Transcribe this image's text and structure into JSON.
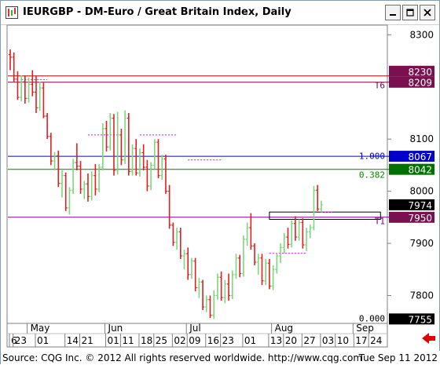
{
  "window": {
    "title": "IEURGBP - DM-Euro / Great Britain Index, Daily",
    "buttons": [
      "minimize",
      "maximize",
      "close"
    ]
  },
  "footer": {
    "source": "Source: CQG Inc. © 2012 All rights reserved worldwide. http://www.cqg.com",
    "date": "Tue Sep 11 2012"
  },
  "colors": {
    "up_bar": "#7cd87c",
    "down_bar": "#e02020",
    "line_red": "#c00000",
    "line_maroon": "#800040",
    "line_blue": "#0000e0",
    "line_green": "#008000",
    "line_purple": "#800080",
    "magenta_dash": "#ff00ff",
    "tag_maroon": "#7b1050",
    "tag_blue": "#0000c8",
    "tag_green": "#007000",
    "tag_black": "#000000"
  },
  "chart_data": {
    "type": "candlestick",
    "title": "IEURGBP - DM-Euro / Great Britain Index, Daily",
    "ylim": [
      7748,
      8317
    ],
    "y_ticks": [
      {
        "value": 8300,
        "label": "8300"
      },
      {
        "value": 8100,
        "label": "8100"
      },
      {
        "value": 8000,
        "label": "8000"
      },
      {
        "value": 7900,
        "label": "7900"
      },
      {
        "value": 7800,
        "label": "7800"
      }
    ],
    "month_labels": [
      {
        "label": "May",
        "day": 5
      },
      {
        "label": "Jun",
        "day": 26
      },
      {
        "label": "Jul",
        "day": 48
      },
      {
        "label": "Aug",
        "day": 71
      },
      {
        "label": "Sep",
        "day": 93
      }
    ],
    "day_labels": [
      {
        "label": "6",
        "day": 0
      },
      {
        "label": "23",
        "day": 1
      },
      {
        "label": "01",
        "day": 7
      },
      {
        "label": "14",
        "day": 15
      },
      {
        "label": "21",
        "day": 19
      },
      {
        "label": "01",
        "day": 26
      },
      {
        "label": "11",
        "day": 30
      },
      {
        "label": "18",
        "day": 35
      },
      {
        "label": "25",
        "day": 39
      },
      {
        "label": "02",
        "day": 44
      },
      {
        "label": "09",
        "day": 48
      },
      {
        "label": "16",
        "day": 53
      },
      {
        "label": "23",
        "day": 57
      },
      {
        "label": "01",
        "day": 63
      },
      {
        "label": "13",
        "day": 70
      },
      {
        "label": "20",
        "day": 74
      },
      {
        "label": "27",
        "day": 79
      },
      {
        "label": "03",
        "day": 84
      },
      {
        "label": "10",
        "day": 88
      },
      {
        "label": "17",
        "day": 93
      },
      {
        "label": "24",
        "day": 97
      }
    ],
    "price_tags": [
      {
        "value": 8230,
        "label": "8230",
        "color": "#7b1050"
      },
      {
        "value": 8209,
        "label": "8209",
        "color": "#7b1050"
      },
      {
        "value": 8067,
        "label": "8067",
        "color": "#0000c8"
      },
      {
        "value": 8042,
        "label": "8042",
        "color": "#007000"
      },
      {
        "value": 7974,
        "label": "7974",
        "color": "#000000"
      },
      {
        "value": 7950,
        "label": "7950",
        "color": "#7b1050"
      },
      {
        "value": 7755,
        "label": "7755",
        "color": "#000000"
      }
    ],
    "horizontal_lines": [
      {
        "value": 8221,
        "color": "#c00000"
      },
      {
        "value": 8209,
        "color": "#800040"
      },
      {
        "value": 8067,
        "color": "#0000e0"
      },
      {
        "value": 8042,
        "color": "#008000"
      },
      {
        "value": 7950,
        "color": "#800080"
      }
    ],
    "line_labels": [
      {
        "value": 8203,
        "label": "T6",
        "color": "#800040"
      },
      {
        "value": 8068,
        "label": "1.000",
        "color": "#0000e0"
      },
      {
        "value": 8032,
        "label": "0.382",
        "color": "#008000"
      },
      {
        "value": 7943,
        "label": "T1",
        "color": "#800080"
      },
      {
        "value": 7756,
        "label": "0.000",
        "color": "#000000"
      }
    ],
    "candles": [
      {
        "o": 8262,
        "h": 8272,
        "l": 8232,
        "c": 8257
      },
      {
        "o": 8257,
        "h": 8266,
        "l": 8210,
        "c": 8215
      },
      {
        "o": 8215,
        "h": 8230,
        "l": 8175,
        "c": 8180
      },
      {
        "o": 8180,
        "h": 8222,
        "l": 8172,
        "c": 8210
      },
      {
        "o": 8210,
        "h": 8222,
        "l": 8168,
        "c": 8178
      },
      {
        "o": 8178,
        "h": 8218,
        "l": 8170,
        "c": 8205
      },
      {
        "o": 8205,
        "h": 8232,
        "l": 8182,
        "c": 8190
      },
      {
        "o": 8190,
        "h": 8222,
        "l": 8150,
        "c": 8160
      },
      {
        "o": 8160,
        "h": 8210,
        "l": 8154,
        "c": 8198
      },
      {
        "o": 8198,
        "h": 8208,
        "l": 8140,
        "c": 8144
      },
      {
        "o": 8144,
        "h": 8150,
        "l": 8100,
        "c": 8105
      },
      {
        "o": 8105,
        "h": 8112,
        "l": 8050,
        "c": 8058
      },
      {
        "o": 8058,
        "h": 8075,
        "l": 8040,
        "c": 8068
      },
      {
        "o": 8068,
        "h": 8078,
        "l": 8008,
        "c": 8015
      },
      {
        "o": 8015,
        "h": 8040,
        "l": 7988,
        "c": 8030
      },
      {
        "o": 8030,
        "h": 8036,
        "l": 7962,
        "c": 7968
      },
      {
        "o": 7968,
        "h": 8008,
        "l": 7955,
        "c": 8002
      },
      {
        "o": 8002,
        "h": 8062,
        "l": 7995,
        "c": 8055
      },
      {
        "o": 8055,
        "h": 8092,
        "l": 8040,
        "c": 8048
      },
      {
        "o": 8048,
        "h": 8058,
        "l": 7995,
        "c": 8004
      },
      {
        "o": 8004,
        "h": 8020,
        "l": 7985,
        "c": 8014
      },
      {
        "o": 8014,
        "h": 8034,
        "l": 7980,
        "c": 7990
      },
      {
        "o": 7990,
        "h": 8038,
        "l": 7982,
        "c": 8030
      },
      {
        "o": 8030,
        "h": 8052,
        "l": 7992,
        "c": 8004
      },
      {
        "o": 8004,
        "h": 8052,
        "l": 7998,
        "c": 8046
      },
      {
        "o": 8046,
        "h": 8130,
        "l": 8040,
        "c": 8120
      },
      {
        "o": 8120,
        "h": 8135,
        "l": 8076,
        "c": 8085
      },
      {
        "o": 8085,
        "h": 8150,
        "l": 8078,
        "c": 8140
      },
      {
        "o": 8140,
        "h": 8148,
        "l": 8030,
        "c": 8040
      },
      {
        "o": 8040,
        "h": 8152,
        "l": 8032,
        "c": 8108
      },
      {
        "o": 8108,
        "h": 8120,
        "l": 8050,
        "c": 8060
      },
      {
        "o": 8060,
        "h": 8155,
        "l": 8052,
        "c": 8140
      },
      {
        "o": 8140,
        "h": 8150,
        "l": 8030,
        "c": 8038
      },
      {
        "o": 8038,
        "h": 8090,
        "l": 8030,
        "c": 8082
      },
      {
        "o": 8082,
        "h": 8100,
        "l": 8030,
        "c": 8035
      },
      {
        "o": 8035,
        "h": 8082,
        "l": 8028,
        "c": 8074
      },
      {
        "o": 8074,
        "h": 8090,
        "l": 8040,
        "c": 8046
      },
      {
        "o": 8046,
        "h": 8060,
        "l": 8000,
        "c": 8010
      },
      {
        "o": 8010,
        "h": 8056,
        "l": 8002,
        "c": 8050
      },
      {
        "o": 8050,
        "h": 8100,
        "l": 8042,
        "c": 8094
      },
      {
        "o": 8094,
        "h": 8100,
        "l": 8025,
        "c": 8030
      },
      {
        "o": 8030,
        "h": 8070,
        "l": 8022,
        "c": 8062
      },
      {
        "o": 8062,
        "h": 8070,
        "l": 7995,
        "c": 8000
      },
      {
        "o": 8000,
        "h": 8012,
        "l": 7928,
        "c": 7935
      },
      {
        "o": 7935,
        "h": 7940,
        "l": 7895,
        "c": 7902
      },
      {
        "o": 7902,
        "h": 7930,
        "l": 7888,
        "c": 7922
      },
      {
        "o": 7922,
        "h": 7930,
        "l": 7870,
        "c": 7876
      },
      {
        "o": 7876,
        "h": 7888,
        "l": 7850,
        "c": 7880
      },
      {
        "o": 7880,
        "h": 7892,
        "l": 7830,
        "c": 7840
      },
      {
        "o": 7840,
        "h": 7872,
        "l": 7832,
        "c": 7866
      },
      {
        "o": 7866,
        "h": 7872,
        "l": 7808,
        "c": 7815
      },
      {
        "o": 7815,
        "h": 7834,
        "l": 7795,
        "c": 7826
      },
      {
        "o": 7826,
        "h": 7830,
        "l": 7772,
        "c": 7778
      },
      {
        "o": 7778,
        "h": 7800,
        "l": 7768,
        "c": 7792
      },
      {
        "o": 7792,
        "h": 7800,
        "l": 7757,
        "c": 7762
      },
      {
        "o": 7762,
        "h": 7810,
        "l": 7755,
        "c": 7800
      },
      {
        "o": 7800,
        "h": 7842,
        "l": 7792,
        "c": 7835
      },
      {
        "o": 7835,
        "h": 7846,
        "l": 7790,
        "c": 7796
      },
      {
        "o": 7796,
        "h": 7830,
        "l": 7785,
        "c": 7822
      },
      {
        "o": 7822,
        "h": 7842,
        "l": 7790,
        "c": 7800
      },
      {
        "o": 7800,
        "h": 7848,
        "l": 7793,
        "c": 7840
      },
      {
        "o": 7840,
        "h": 7880,
        "l": 7832,
        "c": 7872
      },
      {
        "o": 7872,
        "h": 7878,
        "l": 7835,
        "c": 7842
      },
      {
        "o": 7842,
        "h": 7915,
        "l": 7836,
        "c": 7908
      },
      {
        "o": 7908,
        "h": 7940,
        "l": 7895,
        "c": 7930
      },
      {
        "o": 7930,
        "h": 7958,
        "l": 7888,
        "c": 7895
      },
      {
        "o": 7895,
        "h": 7900,
        "l": 7858,
        "c": 7864
      },
      {
        "o": 7864,
        "h": 7880,
        "l": 7840,
        "c": 7872
      },
      {
        "o": 7872,
        "h": 7880,
        "l": 7820,
        "c": 7828
      },
      {
        "o": 7828,
        "h": 7870,
        "l": 7820,
        "c": 7862
      },
      {
        "o": 7862,
        "h": 7870,
        "l": 7812,
        "c": 7818
      },
      {
        "o": 7818,
        "h": 7858,
        "l": 7810,
        "c": 7850
      },
      {
        "o": 7850,
        "h": 7882,
        "l": 7842,
        "c": 7876
      },
      {
        "o": 7876,
        "h": 7900,
        "l": 7862,
        "c": 7892
      },
      {
        "o": 7892,
        "h": 7920,
        "l": 7880,
        "c": 7912
      },
      {
        "o": 7912,
        "h": 7930,
        "l": 7890,
        "c": 7898
      },
      {
        "o": 7898,
        "h": 7944,
        "l": 7892,
        "c": 7938
      },
      {
        "o": 7938,
        "h": 7952,
        "l": 7905,
        "c": 7912
      },
      {
        "o": 7912,
        "h": 7946,
        "l": 7905,
        "c": 7940
      },
      {
        "o": 7940,
        "h": 7948,
        "l": 7890,
        "c": 7897
      },
      {
        "o": 7897,
        "h": 7930,
        "l": 7885,
        "c": 7922
      },
      {
        "o": 7922,
        "h": 7936,
        "l": 7910,
        "c": 7930
      },
      {
        "o": 7930,
        "h": 8010,
        "l": 7925,
        "c": 8002
      },
      {
        "o": 8002,
        "h": 8012,
        "l": 7962,
        "c": 7966
      },
      {
        "o": 7966,
        "h": 7982,
        "l": 7960,
        "c": 7974
      }
    ],
    "candle_day_positions": [
      0,
      1,
      2,
      3,
      4,
      5,
      6,
      7,
      8,
      9,
      10,
      11,
      12,
      13,
      14,
      15,
      16,
      17,
      18,
      19,
      20,
      21,
      22,
      23,
      24,
      25,
      26,
      27,
      28,
      29,
      30,
      31,
      32,
      33,
      34,
      35,
      36,
      37,
      38,
      39,
      40,
      41,
      42,
      43,
      44,
      45,
      46,
      47,
      48,
      49,
      50,
      51,
      52,
      53,
      54,
      55,
      56,
      57,
      58,
      59,
      60,
      61,
      62,
      63,
      64,
      65,
      66,
      67,
      68,
      69,
      70,
      71,
      72,
      73,
      74,
      75,
      76,
      77,
      78,
      79,
      80,
      81,
      82,
      83,
      84
    ],
    "boxes": [
      {
        "day_start": 70,
        "day_end": 100,
        "top": 7960,
        "bottom": 7946,
        "color": "#000000"
      }
    ],
    "dashed_segments": [
      {
        "day_start": 3,
        "day_end": 10,
        "value": 8214
      },
      {
        "day_start": 21,
        "day_end": 29,
        "value": 8108
      },
      {
        "day_start": 35,
        "day_end": 45,
        "value": 8108
      },
      {
        "day_start": 48,
        "day_end": 57,
        "value": 8060
      },
      {
        "day_start": 70,
        "day_end": 80,
        "value": 7881
      },
      {
        "day_start": 84,
        "day_end": 87,
        "value": 7960
      }
    ],
    "x_axis_days": 101
  }
}
